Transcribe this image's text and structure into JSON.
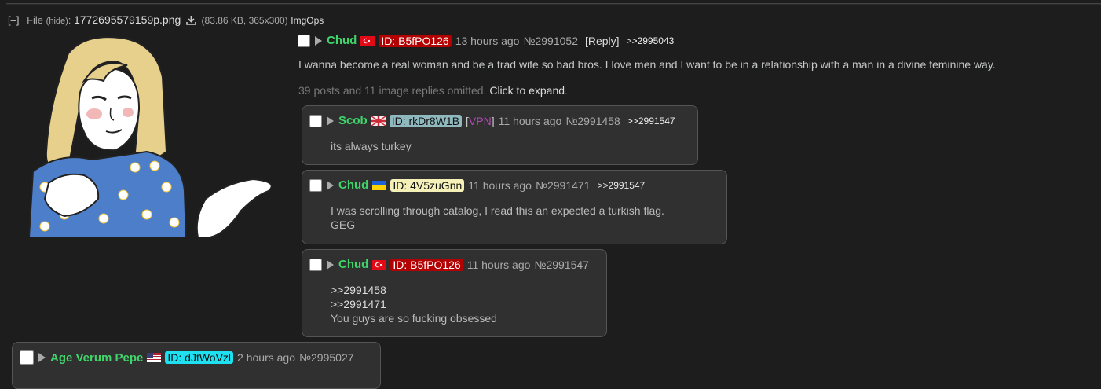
{
  "file": {
    "toggle": "[–]",
    "label": "File",
    "hide": "(hide)",
    "filename": "1772695579159p.png",
    "meta": "(83.86 KB, 365x300)",
    "imgops": "ImgOps"
  },
  "op": {
    "name": "Chud",
    "flag": "turkey",
    "id": "ID: B5fPO126",
    "date": "13 hours ago",
    "no": "№2991052",
    "reply": "[Reply]",
    "backlink": ">>2995043",
    "message": "I wanna become a real woman and be a trad wife so bad bros. I love men and I want to be in a relationship with a man in a divine feminine way.",
    "omitted_text": "39 posts and 11 image replies omitted.",
    "expand_text": "Click to expand",
    "expand_dot": "."
  },
  "replies": [
    {
      "name": "Scob",
      "flag": "uk",
      "id": "ID: rkDr8W1B",
      "vpn_open": "[",
      "vpn": "VPN",
      "vpn_close": "]",
      "date": "11 hours ago",
      "no": "№2991458",
      "backlink": ">>2991547",
      "lines": [
        "its always turkey"
      ]
    },
    {
      "name": "Chud",
      "flag": "ukraine",
      "id": "ID: 4V5zuGnn",
      "date": "11 hours ago",
      "no": "№2991471",
      "backlink": ">>2991547",
      "lines": [
        "I was scrolling through catalog, I read this an expected a turkish flag.",
        "GEG"
      ]
    },
    {
      "name": "Chud",
      "flag": "turkey",
      "id": "ID: B5fPO126",
      "date": "11 hours ago",
      "no": "№2991547",
      "lines": [
        ">>2991458",
        ">>2991471",
        "You guys are so fucking obsessed"
      ]
    },
    {
      "name": "Age Verum Pepe",
      "flag": "usa",
      "id": "ID: dJtWoVzl",
      "date": "2 hours ago",
      "no": "№2995027"
    }
  ],
  "colors": {
    "name_green": "#3fd56b",
    "id_turkey_bg": "#b30000",
    "id_rk_bg": "#8fb9bf",
    "id_4v_bg": "#f4f0b8",
    "id_dj_bg": "#1ee0f0",
    "vpn_purple": "#b44ab9"
  }
}
